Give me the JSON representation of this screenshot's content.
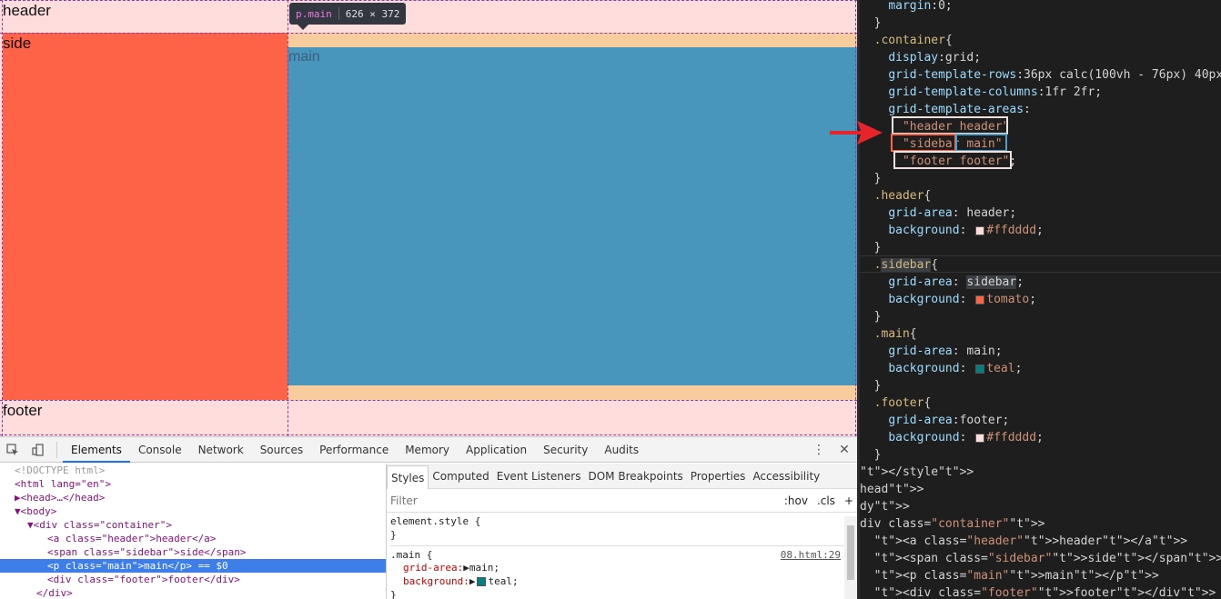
{
  "preview": {
    "header_text": "header",
    "side_text": "side",
    "main_text": "main",
    "footer_text": "footer",
    "tooltip_selector": "p.main",
    "tooltip_size": "626 × 372",
    "colors": {
      "header": "#ffdddd",
      "side": "#ff6347",
      "main": "#4896bc",
      "margin": "#f9cc9d"
    }
  },
  "devtools": {
    "tabs": [
      "Elements",
      "Console",
      "Network",
      "Sources",
      "Performance",
      "Memory",
      "Application",
      "Security",
      "Audits"
    ],
    "active_tab": "Elements",
    "elements_lines": [
      "<!DOCTYPE html>",
      "<html lang=\"en\">",
      "▶<head>…</head>",
      "▼<body>",
      "▼<div class=\"container\">",
      "<a class=\"header\">header</a>",
      "<span class=\"sidebar\">side</span>",
      "<p class=\"main\">main</p> == $0",
      "<div class=\"footer\">footer</div>",
      "</div>"
    ],
    "styles_tabs": [
      "Styles",
      "Computed",
      "Event Listeners",
      "DOM Breakpoints",
      "Properties",
      "Accessibility"
    ],
    "filter_placeholder": "Filter",
    "hov": ":hov",
    "cls": ".cls",
    "element_style": "element.style {",
    "close_brace": "}",
    "main_rule": ".main {",
    "main_source": "08.html:29",
    "grid_area_prop": "grid-area:",
    "grid_area_val": "main;",
    "background_prop": "background:",
    "background_val": "teal;"
  },
  "editor": {
    "lines": [
      {
        "t": "    margin:0;"
      },
      {
        "t": "  }"
      },
      {
        "t": "  .container{"
      },
      {
        "t": "    display:grid;"
      },
      {
        "t": "    grid-template-rows:36px calc(100vh - 76px) 40px;"
      },
      {
        "t": "    grid-template-columns:1fr 2fr;"
      },
      {
        "t": "    grid-template-areas:"
      },
      {
        "t": "      \"header header\""
      },
      {
        "t": "      \"sidebar main\""
      },
      {
        "t": "      \"footer footer\";"
      },
      {
        "t": "  }"
      },
      {
        "t": "  .header{"
      },
      {
        "t": "    grid-area: header;"
      },
      {
        "t": "    background: #ffdddd;"
      },
      {
        "t": "  }"
      },
      {
        "t": "  .sidebar{"
      },
      {
        "t": "    grid-area: sidebar;"
      },
      {
        "t": "    background: tomato;"
      },
      {
        "t": "  }"
      },
      {
        "t": "  .main{"
      },
      {
        "t": "    grid-area: main;"
      },
      {
        "t": "    background: teal;"
      },
      {
        "t": "  }"
      },
      {
        "t": "  .footer{"
      },
      {
        "t": "    grid-area:footer;"
      },
      {
        "t": "    background: #ffdddd;"
      },
      {
        "t": "  }"
      },
      {
        "t": "</style>"
      },
      {
        "t": "head>"
      },
      {
        "t": "dy>"
      },
      {
        "t": "div class=\"container\">"
      },
      {
        "t": "  <a class=\"header\">header</a>"
      },
      {
        "t": "  <span class=\"sidebar\">side</span>"
      },
      {
        "t": "  <p class=\"main\">main</p>"
      },
      {
        "t": "  <div class=\"footer\">footer</div>"
      }
    ],
    "arrow_color": "#e8242a"
  }
}
